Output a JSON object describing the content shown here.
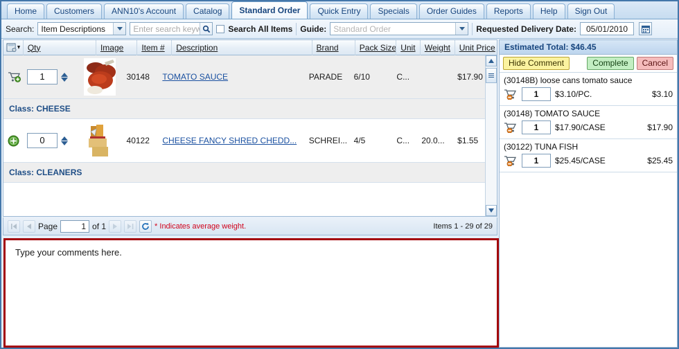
{
  "tabs": [
    {
      "label": "Home",
      "active": false
    },
    {
      "label": "Customers",
      "active": false
    },
    {
      "label": "ANN10's Account",
      "active": false
    },
    {
      "label": "Catalog",
      "active": false
    },
    {
      "label": "Standard Order",
      "active": true
    },
    {
      "label": "Quick Entry",
      "active": false
    },
    {
      "label": "Specials",
      "active": false
    },
    {
      "label": "Order Guides",
      "active": false
    },
    {
      "label": "Reports",
      "active": false
    },
    {
      "label": "Help",
      "active": false
    },
    {
      "label": "Sign Out",
      "active": false
    }
  ],
  "searchbar": {
    "search_label": "Search:",
    "search_type_value": "Item Descriptions",
    "keyword_placeholder": "Enter search keyw",
    "keyword_value": "",
    "search_all_items_label": "Search All Items",
    "search_all_items_checked": false,
    "guide_label": "Guide:",
    "guide_value": "Standard Order",
    "delivery_label": "Requested Delivery Date:",
    "delivery_value": "05/01/2010",
    "magnifier_icon": "search-icon",
    "calendar_icon": "calendar-icon"
  },
  "grid": {
    "columns": [
      "Qty",
      "Image",
      "Item #",
      "Description",
      "Brand",
      "Pack Size",
      "Unit",
      "Weight",
      "Unit Price"
    ],
    "settings_icon": "grid-settings-icon",
    "rows": [
      {
        "kind": "item",
        "action_icon": "add-to-cart-icon",
        "qty": "1",
        "item_no": "30148",
        "description": "TOMATO SAUCE",
        "brand": "PARADE",
        "pack_size": "6/10",
        "unit": "C...",
        "weight": "",
        "unit_price": "$17.90"
      },
      {
        "kind": "class",
        "label": "Class: CHEESE"
      },
      {
        "kind": "item",
        "action_icon": "add-circle-icon",
        "qty": "0",
        "item_no": "40122",
        "description": "CHEESE FANCY SHRED CHEDD...",
        "brand": "SCHREI...",
        "pack_size": "4/5",
        "unit": "C...",
        "weight": "20.0...",
        "unit_price": "$1.55"
      },
      {
        "kind": "class",
        "label": "Class: CLEANERS"
      }
    ],
    "scrollbar": {
      "up_icon": "scroll-up-icon",
      "down_icon": "scroll-down-icon",
      "thumb_icon": "scroll-thumb-icon"
    }
  },
  "pager": {
    "first_icon": "first-page-icon",
    "prev_icon": "prev-page-icon",
    "next_icon": "next-page-icon",
    "last_icon": "last-page-icon",
    "refresh_icon": "refresh-icon",
    "page_label": "Page",
    "page_value": "1",
    "of_label": "of 1",
    "avg_weight_note": "* Indicates average weight.",
    "items_count": "Items 1 - 29 of 29"
  },
  "comment": {
    "text": "Type your comments here."
  },
  "cart": {
    "estimated_total": "Estimated Total: $46.45",
    "hide_comment_label": "Hide Comment",
    "complete_label": "Complete",
    "cancel_label": "Cancel",
    "remove_icon": "remove-from-cart-icon",
    "lines": [
      {
        "name": "(30148B) loose cans tomato sauce",
        "qty": "1",
        "unit_price": "$3.10/PC.",
        "extended": "$3.10"
      },
      {
        "name": "(30148) TOMATO SAUCE",
        "qty": "1",
        "unit_price": "$17.90/CASE",
        "extended": "$17.90"
      },
      {
        "name": "(30122) TUNA FISH",
        "qty": "1",
        "unit_price": "$25.45/CASE",
        "extended": "$25.45"
      }
    ]
  },
  "colors": {
    "accent_blue": "#17457e",
    "comment_border_red": "#a4040a",
    "note_red": "#d0021b",
    "link_blue": "#1a50a0",
    "panel_header": "#bdd5ee"
  }
}
